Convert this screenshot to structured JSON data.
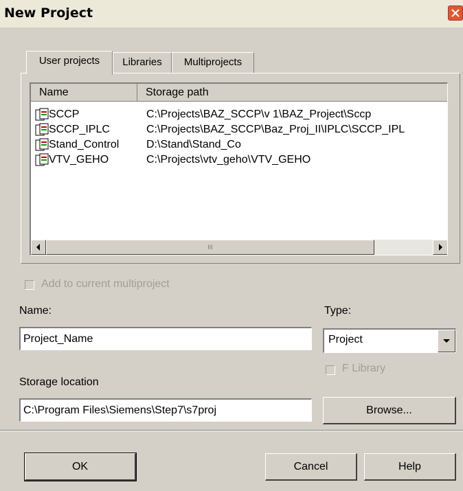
{
  "window": {
    "title": "New Project"
  },
  "tabs": [
    {
      "label": "User projects",
      "active": true
    },
    {
      "label": "Libraries",
      "active": false
    },
    {
      "label": "Multiprojects",
      "active": false
    }
  ],
  "list": {
    "columns": [
      "Name",
      "Storage path"
    ],
    "rows": [
      {
        "name": "SCCP",
        "path": "C:\\Projects\\BAZ_SCCP\\v 1\\BAZ_Project\\Sccp"
      },
      {
        "name": "SCCP_IPLC",
        "path": "C:\\Projects\\BAZ_SCCP\\Baz_Proj_II\\IPLC\\SCCP_IPL"
      },
      {
        "name": "Stand_Control",
        "path": "D:\\Stand\\Stand_Co"
      },
      {
        "name": "VTV_GEHO",
        "path": "C:\\Projects\\vtv_geho\\VTV_GEHO"
      }
    ],
    "scroll_grip": "III"
  },
  "form": {
    "add_to_multiproject_label": "Add to current multiproject",
    "name_label": "Name:",
    "name_value": "Project_Name",
    "type_label": "Type:",
    "type_value": "Project",
    "f_library_label": "F Library",
    "storage_label": "Storage location",
    "storage_value": "C:\\Program Files\\Siemens\\Step7\\s7proj",
    "browse_label": "Browse..."
  },
  "buttons": {
    "ok": "OK",
    "cancel": "Cancel",
    "help": "Help"
  },
  "colors": {
    "face": "#d4d0c8",
    "close": "#e0562e"
  }
}
